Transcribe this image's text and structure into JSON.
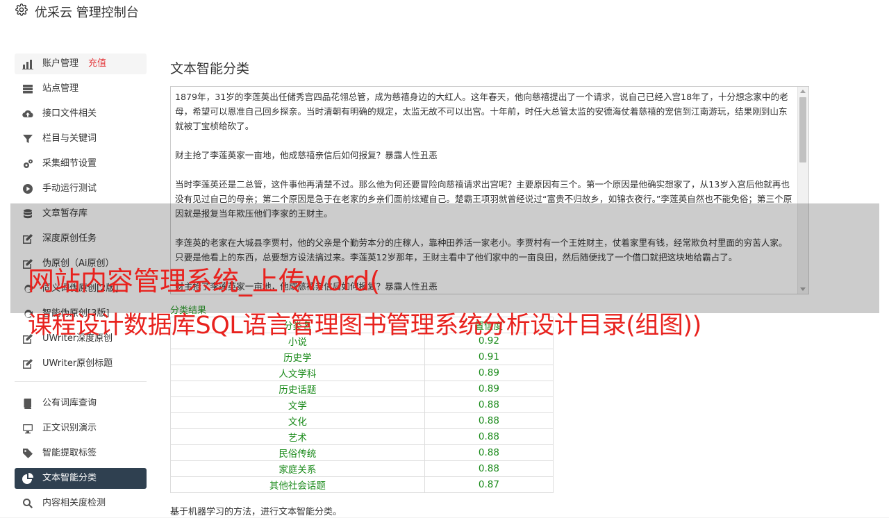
{
  "app": {
    "title": "优采云 管理控制台"
  },
  "sidebar": {
    "group1": [
      {
        "label": "账户管理",
        "tag": "充值",
        "icon": "bar-chart-icon"
      },
      {
        "label": "站点管理",
        "icon": "server-icon"
      },
      {
        "label": "接口文件相关",
        "icon": "cloud-upload-icon"
      },
      {
        "label": "栏目与关键词",
        "icon": "filter-icon"
      },
      {
        "label": "采集细节设置",
        "icon": "gears-icon"
      },
      {
        "label": "手动运行测试",
        "icon": "play-circle-icon"
      },
      {
        "label": "文章暂存库",
        "icon": "database-icon"
      },
      {
        "label": "深度原创任务",
        "icon": "edit-icon"
      },
      {
        "label": "伪原创（Ai原创）",
        "icon": "edit-icon"
      },
      {
        "label": "同义词伪原创[2版]",
        "icon": "refresh-icon"
      },
      {
        "label": "智能伪原创[3版]",
        "icon": "refresh-icon"
      },
      {
        "label": "UWriter深度原创",
        "icon": "edit-icon"
      },
      {
        "label": "UWriter原创标题",
        "icon": "edit-icon"
      }
    ],
    "group2": [
      {
        "label": "公有词库查询",
        "icon": "book-icon"
      },
      {
        "label": "正文识别演示",
        "icon": "desktop-icon"
      },
      {
        "label": "智能提取标签",
        "icon": "tag-icon"
      },
      {
        "label": "文本智能分类",
        "icon": "pie-chart-icon",
        "active": true
      },
      {
        "label": "内容相关度检测",
        "icon": "search-icon"
      }
    ]
  },
  "main": {
    "title": "文本智能分类",
    "input_text": "1879年，31岁的李莲英出任储秀宫四品花翎总管，成为慈禧身边的大红人。这年春天，他向慈禧提出了一个请求，说自己已经入宫18年了，十分想念家中的老母，希望可以恩准自己回乡探亲。当时清朝有明确的规定，太监无故不可以出宫。十年前，时任大总管太监的安德海仗着慈禧的宠信到江南游玩，结果刚到山东就被丁宝桢给砍了。\n\n财主抢了李莲英家一亩地，他成慈禧亲信后如何报复？暴露人性丑恶\n\n当时李莲英还是二总管，这件事他再清楚不过。那么他为何还要冒险向慈禧请求出宫呢？主要原因有三个。第一个原因是他确实想家了，从13岁入宫后他就再也没有见过自己的母亲；第二个原因是急于在老家的乡亲们面前炫耀自己。楚霸王项羽就曾经说过“富贵不归故乡，如锦衣夜行。”李莲英自然也不能免俗；第三个原因就是报复当年欺压他们李家的王财主。\n\n李莲英的老家在大城县李贾村，他的父亲是个勤劳本分的庄稼人，靠种田养活一家老小。李贾村有一个王姓财主，仗着家里有钱，经常欺负村里面的穷苦人家。只要是他看上的东西，总要想方设法搞过来。李莲英12岁那年，王财主看中了他们家中的一亩良田，然后随便找了一个借口就把这块地给霸占了。\n\n财主抢了李莲英家一亩地，他成慈禧亲信后如何报复？暴露人性丑恶",
    "result_label": "分类结果",
    "table_headers": [
      "分类名",
      "置信度"
    ],
    "rows": [
      [
        "小说",
        "0.92"
      ],
      [
        "历史学",
        "0.91"
      ],
      [
        "人文学科",
        "0.89"
      ],
      [
        "历史话题",
        "0.89"
      ],
      [
        "文学",
        "0.88"
      ],
      [
        "文化",
        "0.88"
      ],
      [
        "艺术",
        "0.88"
      ],
      [
        "民俗传统",
        "0.88"
      ],
      [
        "家庭关系",
        "0.88"
      ],
      [
        "其他社会话题",
        "0.87"
      ]
    ],
    "note": "基于机器学习的方法，进行文本智能分类。"
  },
  "overlay": {
    "line1": "网站内容管理系统_上传word(",
    "line2": "课程设计数据库SQL语言管理图书管理系统分析设计目录(组图))"
  },
  "colors": {
    "active_bg": "#2f4050",
    "result_green": "#1a8a1a",
    "tag_red": "#e4393c",
    "overlay_red": "#e8221e"
  }
}
